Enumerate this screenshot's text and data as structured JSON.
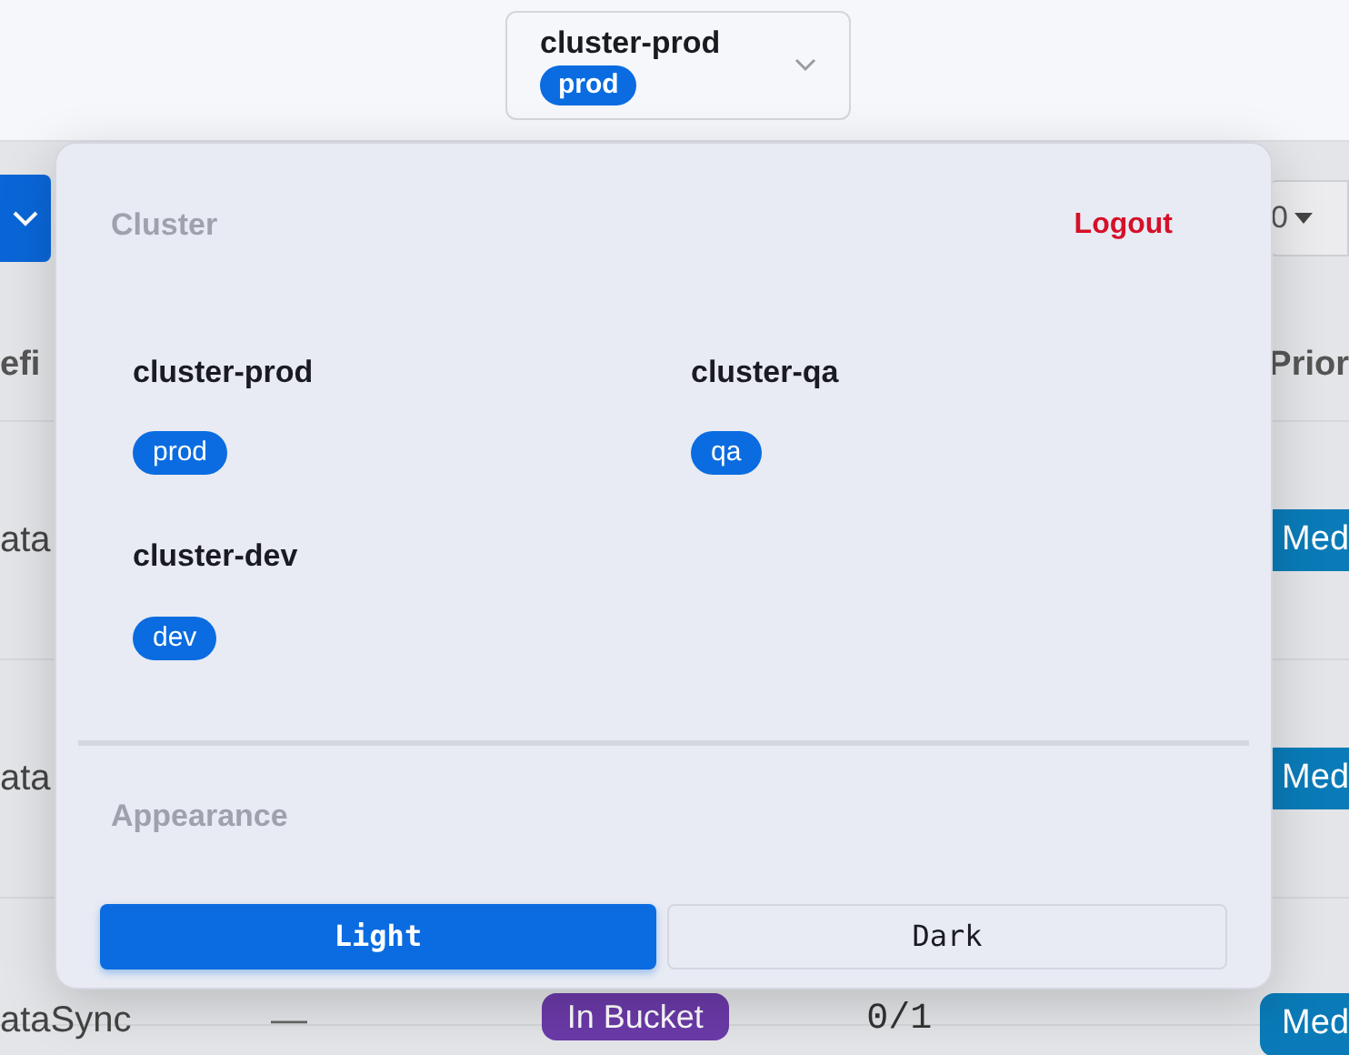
{
  "top_bar": {
    "cluster_selector": {
      "name": "cluster-prod",
      "tag": "prod"
    }
  },
  "toolbar": {
    "select_value": "0"
  },
  "table": {
    "columns": [
      "efi",
      "Prior"
    ],
    "rows": [
      {
        "name": "ata",
        "column_2": "",
        "status": "",
        "count": "",
        "priority": "Med"
      },
      {
        "name": "ata",
        "column_2": "",
        "status": "",
        "count": "",
        "priority": "Med"
      },
      {
        "name": "ataSync",
        "column_2": "—",
        "status": "In Bucket",
        "count": "0/1",
        "priority": "Med"
      }
    ]
  },
  "popover": {
    "cluster_heading": "Cluster",
    "logout": "Logout",
    "clusters": [
      {
        "name": "cluster-prod",
        "tag": "prod"
      },
      {
        "name": "cluster-qa",
        "tag": "qa"
      },
      {
        "name": "cluster-dev",
        "tag": "dev"
      }
    ],
    "appearance_heading": "Appearance",
    "themes": [
      {
        "label": "Light",
        "selected": true
      },
      {
        "label": "Dark",
        "selected": false
      }
    ]
  }
}
